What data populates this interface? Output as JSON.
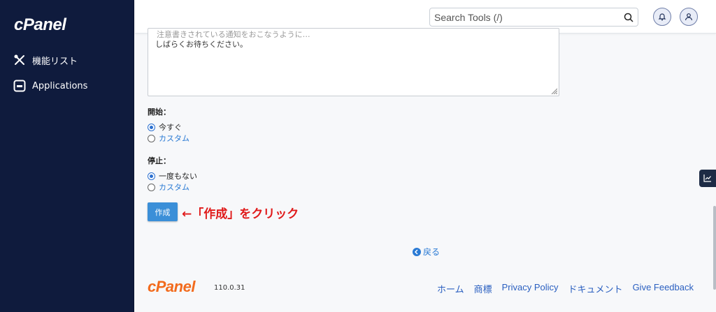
{
  "sidebar": {
    "brand": "cPanel",
    "items": [
      {
        "label": "機能リスト",
        "icon": "tools-icon"
      },
      {
        "label": "Applications",
        "icon": "applications-icon"
      }
    ]
  },
  "header": {
    "search_placeholder": "Search Tools (/)",
    "icons": [
      "search-icon",
      "bell-icon",
      "user-icon"
    ]
  },
  "message": {
    "partial_line": "注意書きされている通知をおこなうように…",
    "line": "しばらくお待ちください。"
  },
  "start": {
    "label": "開始：",
    "options": [
      {
        "label": "今すぐ",
        "selected": true
      },
      {
        "label": "カスタム",
        "selected": false
      }
    ]
  },
  "stop": {
    "label": "停止：",
    "options": [
      {
        "label": "一度もない",
        "selected": true
      },
      {
        "label": "カスタム",
        "selected": false
      }
    ]
  },
  "create_button": "作成",
  "annotation": "←「作成」をクリック",
  "back_link": "戻る",
  "footer": {
    "logo": "cPanel",
    "version": "110.0.31",
    "links": [
      "ホーム",
      "商標",
      "Privacy Policy",
      "ドキュメント",
      "Give Feedback"
    ]
  },
  "colors": {
    "sidebar_bg": "#0f1b3d",
    "accent": "#3b8fd8",
    "annotation": "#e01a1a",
    "footer_logo": "#f26b1d"
  }
}
